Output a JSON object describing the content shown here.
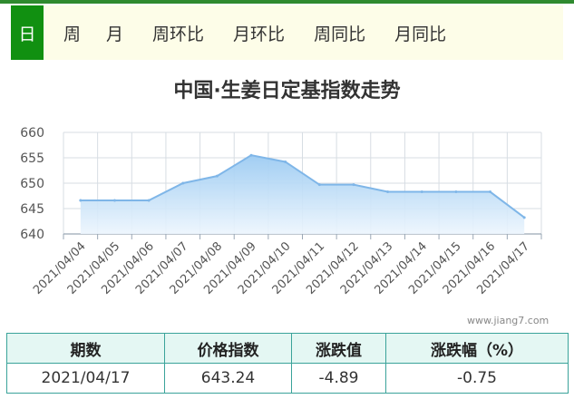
{
  "tabs": [
    {
      "label": "日",
      "active": true
    },
    {
      "label": "周",
      "active": false
    },
    {
      "label": "月",
      "active": false
    },
    {
      "label": "周环比",
      "active": false
    },
    {
      "label": "月环比",
      "active": false
    },
    {
      "label": "周同比",
      "active": false
    },
    {
      "label": "月同比",
      "active": false
    }
  ],
  "watermark": "www.jiang7.com",
  "chart_data": {
    "type": "area",
    "title": "中国·生姜日定基指数走势",
    "xlabel": "",
    "ylabel": "",
    "ylim": [
      640,
      660
    ],
    "yticks": [
      640,
      645,
      650,
      655,
      660
    ],
    "grid": true,
    "categories": [
      "2021/04/04",
      "2021/04/05",
      "2021/04/06",
      "2021/04/07",
      "2021/04/08",
      "2021/04/09",
      "2021/04/10",
      "2021/04/11",
      "2021/04/12",
      "2021/04/13",
      "2021/04/14",
      "2021/04/15",
      "2021/04/16",
      "2021/04/17"
    ],
    "series": [
      {
        "values": [
          646.6,
          646.6,
          646.6,
          650.0,
          651.4,
          655.5,
          654.2,
          649.7,
          649.7,
          648.3,
          648.3,
          648.3,
          648.3,
          643.24
        ]
      }
    ],
    "colors": {
      "line": "#7fb6e8",
      "fill_top": "#9ccbf2",
      "fill_bottom": "#ecf5fd",
      "grid": "#d7dde3"
    }
  },
  "table": {
    "headers": [
      "期数",
      "价格指数",
      "涨跌值",
      "涨跌幅（%）"
    ],
    "rows": [
      [
        "2021/04/17",
        "643.24",
        "-4.89",
        "-0.75"
      ]
    ]
  }
}
